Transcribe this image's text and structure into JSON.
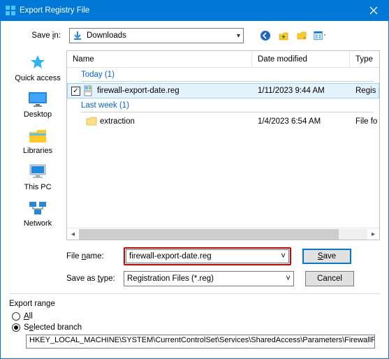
{
  "title": "Export Registry File",
  "savein": {
    "label": "Save in:",
    "value": "Downloads"
  },
  "columns": {
    "name": "Name",
    "date": "Date modified",
    "type": "Type"
  },
  "groups": {
    "today": "Today (1)",
    "lastweek": "Last week (1)"
  },
  "files": {
    "f1": {
      "name": "firewall-export-date.reg",
      "date": "1/11/2023 9:44 AM",
      "type": "Regis"
    },
    "f2": {
      "name": "extraction",
      "date": "1/4/2023 6:54 AM",
      "type": "File fo"
    }
  },
  "form": {
    "filename_label": "File name:",
    "filename_value": "firewall-export-date.reg",
    "savetype_label": "Save as type:",
    "savetype_value": "Registration Files (*.reg)"
  },
  "buttons": {
    "save": "Save",
    "cancel": "Cancel"
  },
  "range": {
    "title": "Export range",
    "all": "All",
    "selected": "Selected branch",
    "branch": "HKEY_LOCAL_MACHINE\\SYSTEM\\CurrentControlSet\\Services\\SharedAccess\\Parameters\\FirewallP"
  },
  "places": {
    "quick": "Quick access",
    "desktop": "Desktop",
    "libraries": "Libraries",
    "thispc": "This PC",
    "network": "Network"
  }
}
